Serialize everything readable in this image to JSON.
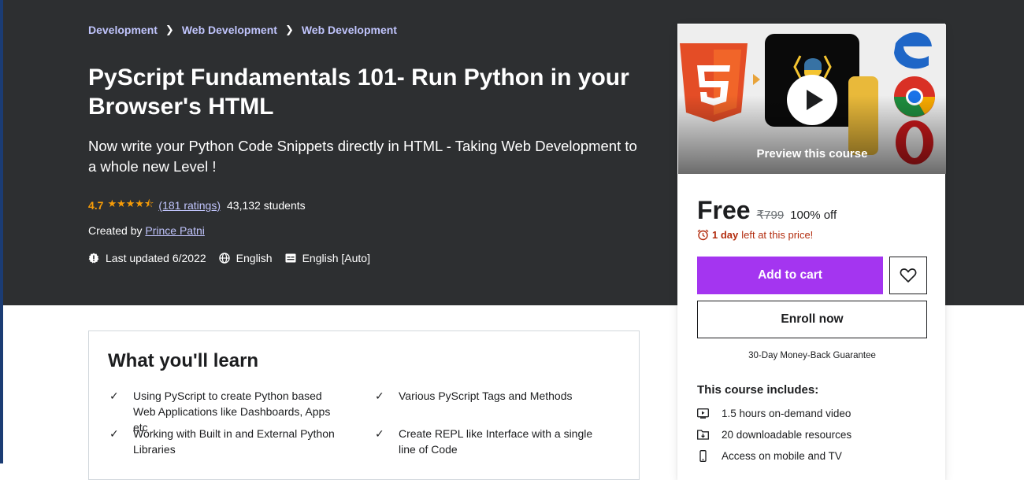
{
  "breadcrumb": [
    "Development",
    "Web Development",
    "Web Development"
  ],
  "course": {
    "title": "PyScript Fundamentals 101- Run Python in your Browser's HTML",
    "subtitle": "Now write your Python Code Snippets directly in HTML - Taking Web Development to a whole new Level !",
    "rating": "4.7",
    "stars": "★★★★⯪",
    "ratings_count": "(181 ratings)",
    "students": "43,132 students",
    "created_by_label": "Created by",
    "instructor": "Prince Patni",
    "last_updated": "Last updated 6/2022",
    "language": "English",
    "captions": "English [Auto]"
  },
  "learn": {
    "title": "What you'll learn",
    "items": [
      "Using PyScript to create Python based Web Applications like Dashboards, Apps etc",
      "Various PyScript Tags and Methods",
      "Working with Built in and External Python Libraries",
      "Create REPL like Interface with a single line of Code"
    ]
  },
  "sidebar": {
    "preview_label": "Preview this course",
    "price": "Free",
    "original_price": "₹799",
    "discount": "100% off",
    "timer_bold": "1 day",
    "timer_rest": "left at this price!",
    "add_to_cart": "Add to cart",
    "enroll": "Enroll now",
    "guarantee": "30-Day Money-Back Guarantee",
    "includes_title": "This course includes:",
    "includes": [
      "1.5 hours on-demand video",
      "20 downloadable resources",
      "Access on mobile and TV"
    ]
  },
  "colors": {
    "hero_bg": "#2d2f31",
    "accent_purple": "#a435f0",
    "link_lavender": "#c0c4fc",
    "star_orange": "#f69c08",
    "timer_red": "#b32d0f"
  }
}
